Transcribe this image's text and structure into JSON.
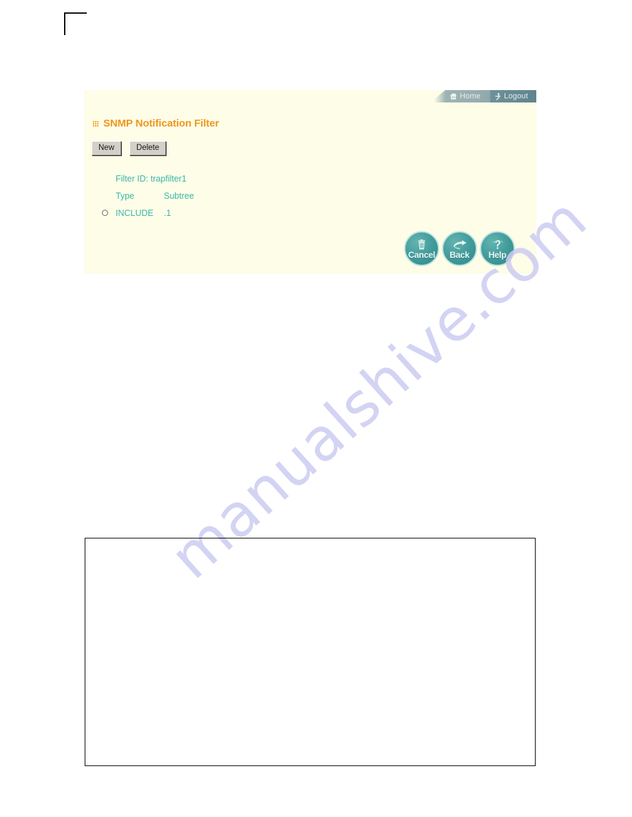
{
  "page": {
    "watermark": "manualshive.com"
  },
  "nav": {
    "home_label": "Home",
    "logout_label": "Logout"
  },
  "panel": {
    "title": "SNMP Notification Filter",
    "buttons": {
      "new_label": "New",
      "delete_label": "Delete"
    },
    "filter": {
      "id_label": "Filter ID: trapfilter1",
      "type_header": "Type",
      "subtree_header": "Subtree",
      "row_type": "INCLUDE",
      "row_subtree": ".1",
      "radio_selected": false
    },
    "actions": [
      {
        "label": "Cancel",
        "icon": "trash-icon"
      },
      {
        "label": "Back",
        "icon": "hand-pointer-icon"
      },
      {
        "label": "Help",
        "icon": "question-mark-icon"
      }
    ]
  },
  "colors": {
    "panel_bg": "#fdfde8",
    "title_orange": "#f0961e",
    "text_teal": "#3bb6a8",
    "button_teal": "#3f9a99",
    "watermark": "#ccccf2"
  }
}
